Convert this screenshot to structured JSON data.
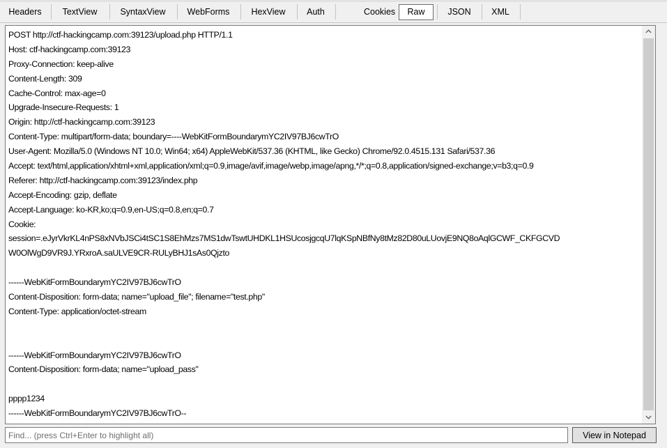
{
  "tabs": [
    {
      "label": "Headers",
      "active": false
    },
    {
      "label": "TextView",
      "active": false
    },
    {
      "label": "SyntaxView",
      "active": false
    },
    {
      "label": "WebForms",
      "active": false
    },
    {
      "label": "HexView",
      "active": false
    },
    {
      "label": "Auth",
      "active": false
    },
    {
      "label": "Cookies",
      "active": false
    },
    {
      "label": "Raw",
      "active": true
    },
    {
      "label": "JSON",
      "active": false
    },
    {
      "label": "XML",
      "active": false
    }
  ],
  "request": {
    "lines": [
      "POST http://ctf-hackingcamp.com:39123/upload.php HTTP/1.1",
      "Host: ctf-hackingcamp.com:39123",
      "Proxy-Connection: keep-alive",
      "Content-Length: 309",
      "Cache-Control: max-age=0",
      "Upgrade-Insecure-Requests: 1",
      "Origin: http://ctf-hackingcamp.com:39123",
      "Content-Type: multipart/form-data; boundary=----WebKitFormBoundarymYC2IV97BJ6cwTrO",
      "User-Agent: Mozilla/5.0 (Windows NT 10.0; Win64; x64) AppleWebKit/537.36 (KHTML, like Gecko) Chrome/92.0.4515.131 Safari/537.36",
      "Accept: text/html,application/xhtml+xml,application/xml;q=0.9,image/avif,image/webp,image/apng,*/*;q=0.8,application/signed-exchange;v=b3;q=0.9",
      "Referer: http://ctf-hackingcamp.com:39123/index.php",
      "Accept-Encoding: gzip, deflate",
      "Accept-Language: ko-KR,ko;q=0.9,en-US;q=0.8,en;q=0.7",
      "Cookie:",
      "session=.eJyrVkrKL4nPS8xNVbJSCi4tSC1S8EhMzs7MS1dwTswtUHDKL1HSUcosjgcqU7lqKSpNBfNy8tMz82D80uLUovjE9NQ8oAqlGCWF_CKFGCVD",
      "W0OlWgD9VR9J.YRxroA.saULVE9CR-RULyBHJ1sAs0Qjzto",
      "",
      "------WebKitFormBoundarymYC2IV97BJ6cwTrO",
      "Content-Disposition: form-data; name=\"upload_file\"; filename=\"test.php\"",
      "Content-Type: application/octet-stream",
      "",
      "",
      "------WebKitFormBoundarymYC2IV97BJ6cwTrO",
      "Content-Disposition: form-data; name=\"upload_pass\"",
      "",
      "pppp1234",
      "------WebKitFormBoundarymYC2IV97BJ6cwTrO--"
    ]
  },
  "scrollbar": {
    "up_icon": "chevron-up-icon",
    "down_icon": "chevron-down-icon"
  },
  "find": {
    "placeholder": "Find... (press Ctrl+Enter to highlight all)",
    "value": ""
  },
  "view_in_notepad_label": "View in Notepad"
}
